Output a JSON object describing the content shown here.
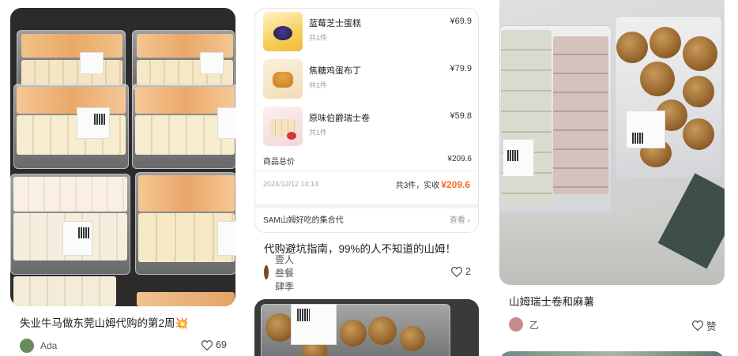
{
  "cards": [
    {
      "title": "失业牛马做东莞山姆代购的第2周💥",
      "author": "Ada",
      "likes": "69",
      "avatar_color": "#6a8a5c"
    },
    {
      "title": "代购避坑指南，99%的人不知道的山姆！",
      "author": "壹人叁餐肆季",
      "likes": "2",
      "avatar_color": "#7a4a2a",
      "receipt": {
        "items": [
          {
            "name": "蓝莓芝士蛋糕",
            "count": "共1件",
            "price": "¥69.9"
          },
          {
            "name": "焦糖鸡蛋布丁",
            "count": "共1件",
            "price": "¥79.9"
          },
          {
            "name": "原味伯爵瑞士卷",
            "count": "共1件",
            "price": "¥59.8"
          }
        ],
        "subtotal_label": "商品总价",
        "subtotal": "¥209.6",
        "date": "2024/12/12 14:14",
        "total_prefix": "共3件，实收",
        "total": "¥209.6",
        "store": "SAM山姆好吃的集合代",
        "view": "查看"
      }
    },
    {
      "title": "山姆瑞士卷和麻薯",
      "author": "乙",
      "likes": "赞",
      "avatar_color": "#c98a8a"
    }
  ],
  "colors": {
    "accent_price": "#ff6a1f"
  },
  "icons": [
    "heart-icon",
    "chevron-right-icon"
  ]
}
